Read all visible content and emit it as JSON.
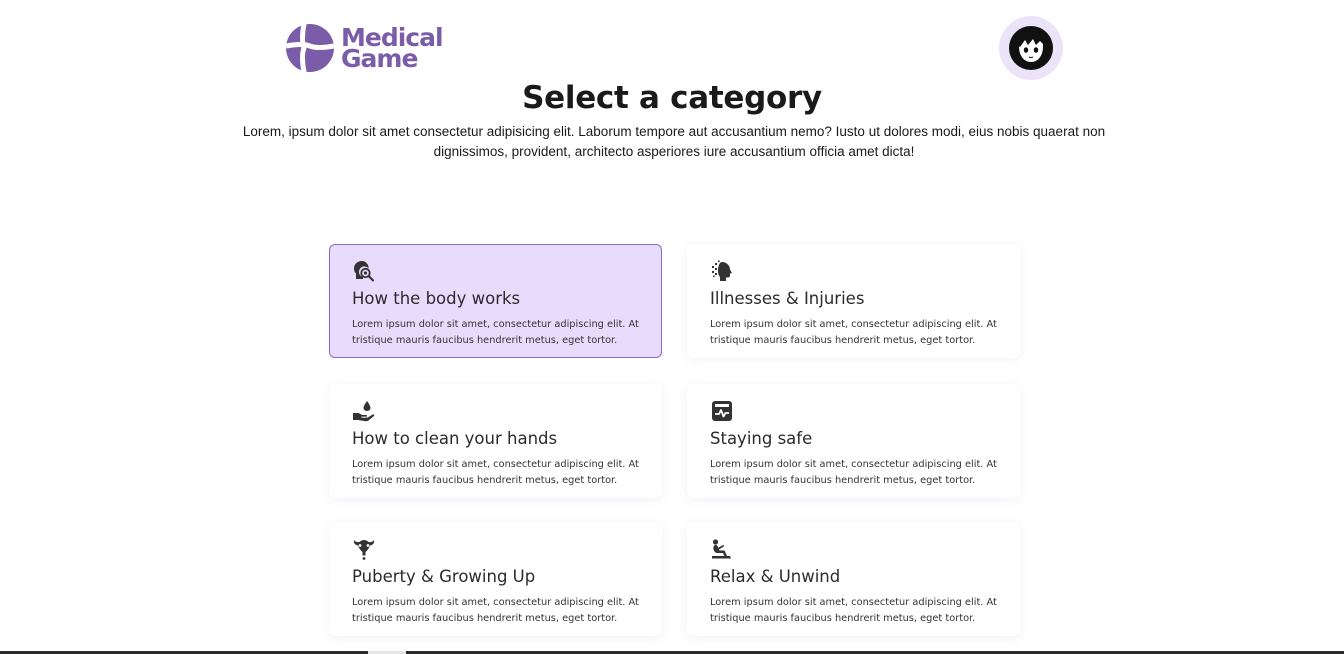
{
  "brand": {
    "line1": "Medical",
    "line2": "Game",
    "color": "#7b5ca8"
  },
  "header": {
    "avatar_icon": "user-avatar-icon"
  },
  "main": {
    "title": "Select a category",
    "intro": "Lorem, ipsum dolor sit amet consectetur adipisicing elit. Laborum tempore aut accusantium nemo? Iusto ut dolores modi, eius nobis quaerat non dignissimos, provident, architecto asperiores iure accusantium officia amet dicta!"
  },
  "categories": [
    {
      "title": "How the body works",
      "description": "Lorem ipsum dolor sit amet, consectetur adipiscing elit. At tristique mauris faucibus hendrerit metus, eget tortor.",
      "icon": "head-search-icon",
      "selected": true
    },
    {
      "title": "Illnesses & Injuries",
      "description": "Lorem ipsum dolor sit amet, consectetur adipiscing elit. At tristique mauris faucibus hendrerit metus, eget tortor.",
      "icon": "dissolving-head-icon",
      "selected": false
    },
    {
      "title": "How to clean your hands",
      "description": "Lorem ipsum dolor sit amet, consectetur adipiscing elit. At tristique mauris faucibus hendrerit metus, eget tortor.",
      "icon": "hand-drop-icon",
      "selected": false
    },
    {
      "title": "Staying safe",
      "description": "Lorem ipsum dolor sit amet, consectetur adipiscing elit. At tristique mauris faucibus hendrerit metus, eget tortor.",
      "icon": "health-monitor-icon",
      "selected": false
    },
    {
      "title": "Puberty & Growing Up",
      "description": "Lorem ipsum dolor sit amet, consectetur adipiscing elit. At tristique mauris faucibus hendrerit metus, eget tortor.",
      "icon": "uterus-icon",
      "selected": false
    },
    {
      "title": "Relax & Unwind",
      "description": "Lorem ipsum dolor sit amet, consectetur adipiscing elit. At tristique mauris faucibus hendrerit metus, eget tortor.",
      "icon": "reclining-person-icon",
      "selected": false
    }
  ],
  "colors": {
    "selected_card_bg": "#e8dcfc",
    "selected_card_border": "#8b6cc4",
    "avatar_bg": "#ebe3f7"
  }
}
